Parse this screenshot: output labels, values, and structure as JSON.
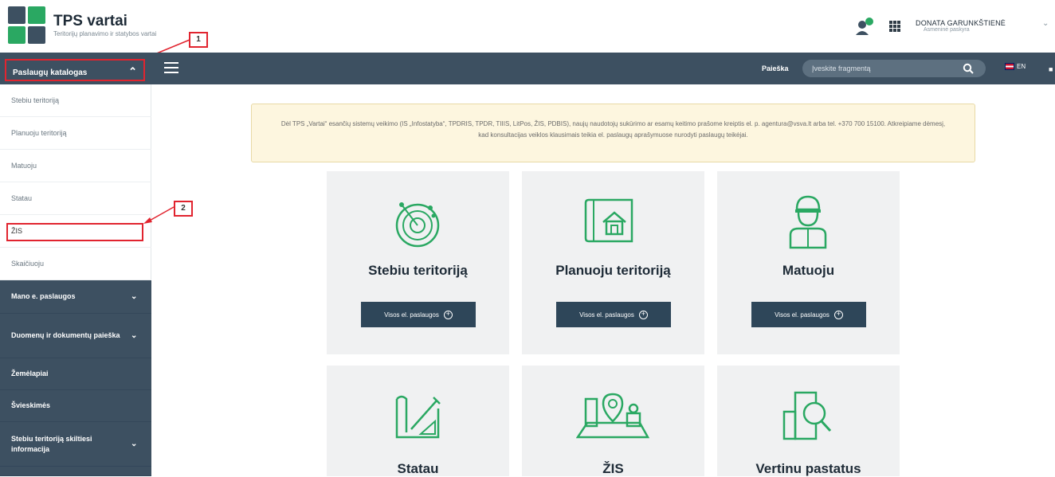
{
  "header": {
    "brand_title": "TPS vartai",
    "brand_subtitle": "Teritorijų planavimo ir statybos vartai",
    "user_name": "DONATA GARUNKŠTIENĖ",
    "user_role": "Asmeninė paskyra",
    "annotation_1": "1",
    "annotation_2": "2"
  },
  "navbar": {
    "catalog_label": "Paslaugų katalogas",
    "search_label": "Paieška",
    "search_placeholder": "Įveskite fragmentą",
    "language": "EN"
  },
  "sidebar": {
    "items": [
      {
        "label": "Stebiu teritoriją"
      },
      {
        "label": "Planuoju teritoriją"
      },
      {
        "label": "Matuoju"
      },
      {
        "label": "Statau"
      },
      {
        "label": "ŽIS"
      },
      {
        "label": "Skaičiuoju"
      }
    ],
    "sections": [
      {
        "label": "Mano e. paslaugos"
      },
      {
        "label": "Duomenų ir dokumentų paieška"
      },
      {
        "label": "Žemėlapiai"
      },
      {
        "label": "Švieskimės"
      },
      {
        "label": "Stebiu teritoriją skiltiesi informacija"
      }
    ]
  },
  "notice": {
    "text": "Dėl TPS „Vartai“ esančių sistemų veikimo (IS „Infostatyba“, TPDRIS, TPDR, TIIIS, LitPos, ŽIS, PDBIS), naujų naudotojų sukūrimo ar esamų keitimo prašome kreiptis el. p. agentura@vsva.lt arba tel. +370 700 15100. Atkreipiame dėmesį, kad konsultacijas veiklos klausimais teikia el. paslaugų aprašymuose nurodyti paslaugų teikėjai."
  },
  "cards": [
    {
      "title": "Stebiu teritoriją",
      "button": "Visos el. paslaugos"
    },
    {
      "title": "Planuoju teritoriją",
      "button": "Visos el. paslaugos"
    },
    {
      "title": "Matuoju",
      "button": "Visos el. paslaugos"
    },
    {
      "title": "Statau",
      "button": ""
    },
    {
      "title": "ŽIS",
      "button": ""
    },
    {
      "title": "Vertinu pastatus",
      "button": ""
    }
  ],
  "colors": {
    "navbar": "#3d5061",
    "accent_green": "#2aa862",
    "button_dark": "#2e4659",
    "annotation_red": "#e1242f",
    "notice_bg": "#fdf6df"
  }
}
